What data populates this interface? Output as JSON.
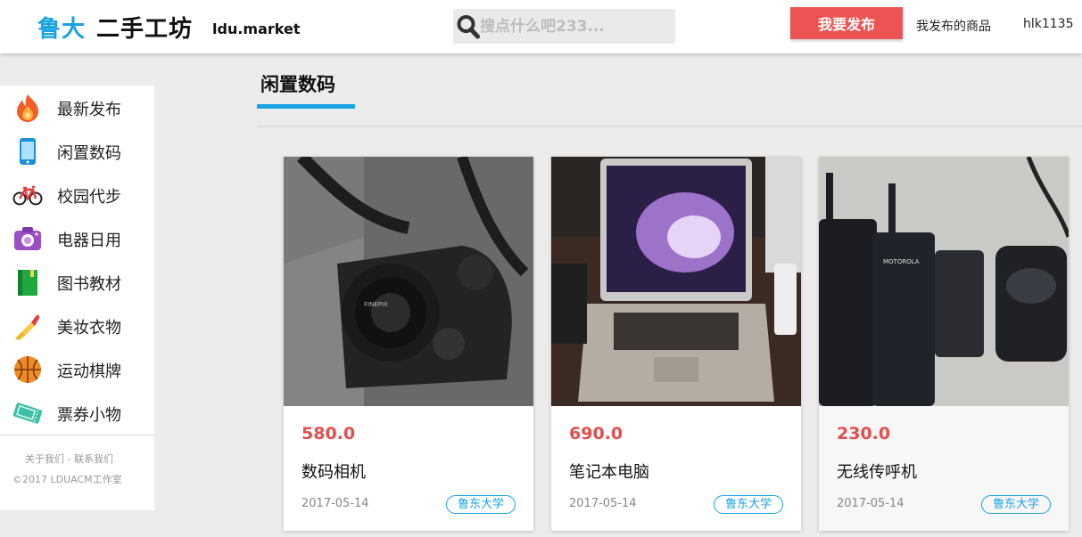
{
  "header": {
    "logo_part1": "鲁大",
    "logo_part2": "二手工坊",
    "logo_sub": "ldu.market",
    "search_placeholder": "搜点什么吧233...",
    "publish_label": "我要发布",
    "my_items_label": "我发布的商品",
    "username": "hlk1135"
  },
  "sidebar": {
    "items": [
      {
        "label": "最新发布",
        "icon": "flame-icon"
      },
      {
        "label": "闲置数码",
        "icon": "phone-icon"
      },
      {
        "label": "校园代步",
        "icon": "bicycle-icon"
      },
      {
        "label": "电器日用",
        "icon": "camera-icon"
      },
      {
        "label": "图书教材",
        "icon": "book-icon"
      },
      {
        "label": "美妆衣物",
        "icon": "lipstick-icon"
      },
      {
        "label": "运动棋牌",
        "icon": "basketball-icon"
      },
      {
        "label": "票券小物",
        "icon": "ticket-icon"
      }
    ],
    "footer_links": "关于我们 - 联系我们",
    "copyright": "©2017 LDUACM工作室"
  },
  "main": {
    "section_title": "闲置数码",
    "products": [
      {
        "price": "580.0",
        "name": "数码相机",
        "date": "2017-05-14",
        "school": "鲁东大学",
        "image": "digital-camera-photo"
      },
      {
        "price": "690.0",
        "name": "笔记本电脑",
        "date": "2017-05-14",
        "school": "鲁东大学",
        "image": "laptop-photo"
      },
      {
        "price": "230.0",
        "name": "无线传呼机",
        "date": "2017-05-14",
        "school": "鲁东大学",
        "image": "walkie-talkie-photo"
      }
    ]
  },
  "colors": {
    "accent_blue": "#19a3e3",
    "publish_red": "#ec5453",
    "price_red": "#e64d4d"
  }
}
